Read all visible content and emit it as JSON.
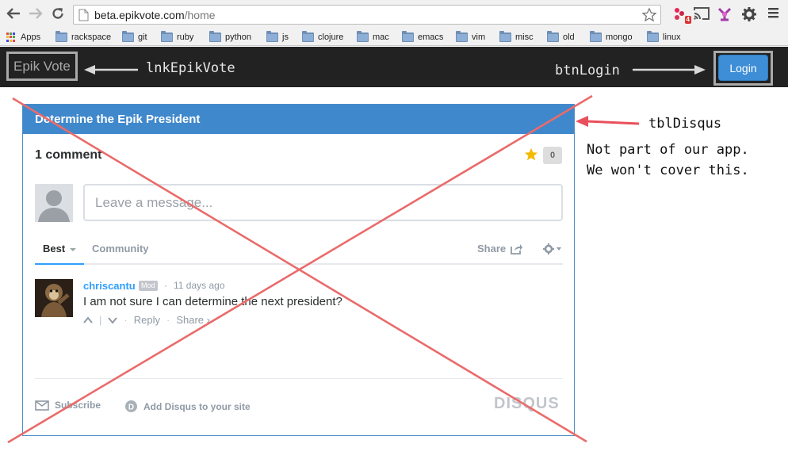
{
  "browser": {
    "url_domain": "beta.epikvote.com",
    "url_path": "/home",
    "extension_badge": "4",
    "bookmarks": [
      {
        "label": "Apps",
        "icon": "apps-grid-icon"
      },
      {
        "label": "rackspace",
        "icon": "folder-icon"
      },
      {
        "label": "git",
        "icon": "folder-icon"
      },
      {
        "label": "ruby",
        "icon": "folder-icon"
      },
      {
        "label": "python",
        "icon": "folder-icon"
      },
      {
        "label": "js",
        "icon": "folder-icon"
      },
      {
        "label": "clojure",
        "icon": "folder-icon"
      },
      {
        "label": "mac",
        "icon": "folder-icon"
      },
      {
        "label": "emacs",
        "icon": "folder-icon"
      },
      {
        "label": "vim",
        "icon": "folder-icon"
      },
      {
        "label": "misc",
        "icon": "folder-icon"
      },
      {
        "label": "old",
        "icon": "folder-icon"
      },
      {
        "label": "mongo",
        "icon": "folder-icon"
      },
      {
        "label": "linux",
        "icon": "folder-icon"
      }
    ]
  },
  "navbar": {
    "brand": "Epik Vote",
    "login_label": "Login",
    "background": "#222222",
    "button_color": "#3d8ed6"
  },
  "annotations": {
    "brand_label": "lnkEpikVote",
    "login_label": "btnLogin",
    "disqus_label": "tblDisqus",
    "note_line1": "Not part of our app.",
    "note_line2": "We won't cover this.",
    "arrow_color": "#e8505b"
  },
  "disqus": {
    "header_title": "Determine the Epik President",
    "header_color": "#4088cc",
    "comment_count": "1 comment",
    "favorites": "0",
    "input_placeholder": "Leave a message...",
    "tab_best": "Best",
    "tab_community": "Community",
    "share_label": "Share",
    "comment": {
      "author": "chriscantu",
      "badge": "Mod",
      "separator": "·",
      "time": "11 days ago",
      "body": "I am not sure I can determine the next president?",
      "reply": "Reply",
      "share": "Share ›"
    },
    "footer": {
      "subscribe": "Subscribe",
      "add_disqus": "Add Disqus to your site",
      "logo": "DISQUS"
    }
  }
}
